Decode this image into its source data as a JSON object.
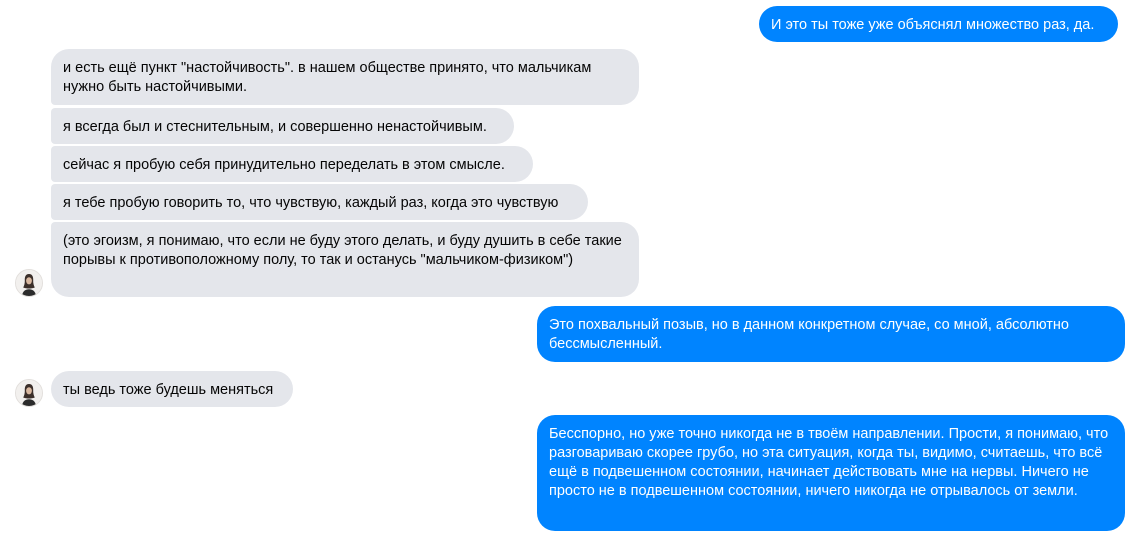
{
  "conversation": {
    "messages": [
      {
        "sender": "me",
        "text": "И это ты тоже уже объяснял множество раз, да."
      },
      {
        "sender": "them",
        "text": "и есть ещё пункт \"настойчивость\". в нашем обществе принято, что мальчикам нужно быть настойчивыми."
      },
      {
        "sender": "them",
        "text": "я всегда был и стеснительным, и совершенно ненастойчивым."
      },
      {
        "sender": "them",
        "text": "сейчас я пробую себя принудительно переделать в этом смысле."
      },
      {
        "sender": "them",
        "text": "я тебе пробую говорить то, что чувствую, каждый раз, когда это чувствую"
      },
      {
        "sender": "them",
        "text": "(это эгоизм, я понимаю, что если не буду этого делать, и буду душить в себе такие порывы к противоположному полу, то так и останусь \"мальчиком-физиком\")"
      },
      {
        "sender": "me",
        "text": "Это похвальный позыв, но в данном конкретном случае, со мной, абсолютно бессмысленный."
      },
      {
        "sender": "them",
        "text": "ты ведь тоже будешь меняться"
      },
      {
        "sender": "me",
        "text": "Бесспорно, но уже точно никогда не в твоём направлении. Прости, я понимаю, что разговариваю скорее грубо, но эта ситуация, когда ты, видимо, считаешь, что всё ещё в подвешенном состоянии, начинает действовать мне на нервы. Ничего не просто не в подвешенном состоянии, ничего никогда не отрывалось от земли."
      }
    ],
    "avatar_icon": "contact-avatar-icon"
  },
  "colors": {
    "outgoing_bubble": "#0084ff",
    "outgoing_text": "#ffffff",
    "incoming_bubble": "#e4e6eb",
    "incoming_text": "#050505",
    "background": "#ffffff"
  }
}
